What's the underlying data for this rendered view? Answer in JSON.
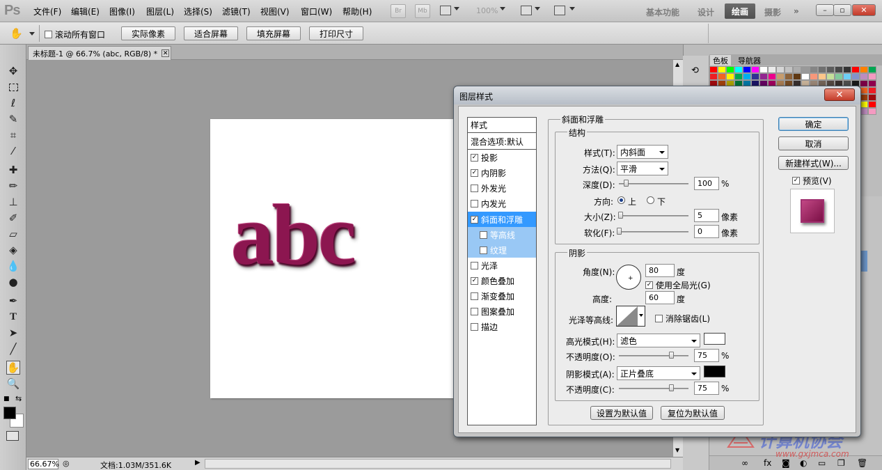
{
  "app": {
    "logo": "Ps"
  },
  "menu": [
    "文件(F)",
    "编辑(E)",
    "图像(I)",
    "图层(L)",
    "选择(S)",
    "滤镜(T)",
    "视图(V)",
    "窗口(W)",
    "帮助(H)"
  ],
  "topbar": {
    "br_label": "Br",
    "mb_label": "Mb",
    "zoom": "100%"
  },
  "workspaces": [
    "基本功能",
    "设计",
    "绘画",
    "摄影"
  ],
  "workspace_active": "绘画",
  "window_buttons": {
    "minimize": "–",
    "restore": "▫",
    "close": "✕"
  },
  "options": {
    "scroll_all": "滚动所有窗口",
    "buttons": [
      "实际像素",
      "适合屏幕",
      "填充屏幕",
      "打印尺寸"
    ]
  },
  "document": {
    "tab_title": "未标题-1 @ 66.7% (abc, RGB/8) *",
    "canvas_text": "abc",
    "zoom": "66.67%",
    "doc_info": "文档:1.03M/351.6K"
  },
  "panels": {
    "tabs": [
      "色板",
      "导航器"
    ]
  },
  "watermark": {
    "name": "计算机协会",
    "url": "www.gxjmca.com"
  },
  "dialog": {
    "title": "图层样式",
    "styles_header": "样式",
    "blend_default": "混合选项:默认",
    "effects": [
      {
        "label": "投影",
        "checked": "✓"
      },
      {
        "label": "内阴影",
        "checked": "✓"
      },
      {
        "label": "外发光",
        "checked": ""
      },
      {
        "label": "内发光",
        "checked": ""
      },
      {
        "label": "斜面和浮雕",
        "checked": "✓"
      },
      {
        "label": "等高线",
        "checked": ""
      },
      {
        "label": "纹理",
        "checked": ""
      },
      {
        "label": "光泽",
        "checked": ""
      },
      {
        "label": "颜色叠加",
        "checked": "✓"
      },
      {
        "label": "渐变叠加",
        "checked": ""
      },
      {
        "label": "图案叠加",
        "checked": ""
      },
      {
        "label": "描边",
        "checked": ""
      }
    ],
    "section_title": "斜面和浮雕",
    "structure": {
      "title": "结构",
      "style_label": "样式(T):",
      "style_value": "内斜面",
      "technique_label": "方法(Q):",
      "technique_value": "平滑",
      "depth_label": "深度(D):",
      "depth_value": "100",
      "depth_unit": "%",
      "depth_level": 0.1,
      "direction_label": "方向:",
      "dir_up": "上",
      "dir_down": "下",
      "size_label": "大小(Z):",
      "size_value": "5",
      "size_unit": "像素",
      "size_level": 0.02,
      "soften_label": "软化(F):",
      "soften_value": "0",
      "soften_unit": "像素",
      "soften_level": 0.0
    },
    "shading": {
      "title": "阴影",
      "angle_label": "角度(N):",
      "angle_value": "80",
      "angle_unit": "度",
      "global_light": "使用全局光(G)",
      "altitude_label": "高度:",
      "altitude_value": "60",
      "altitude_unit": "度",
      "gloss_label": "光泽等高线:",
      "anti_alias": "消除锯齿(L)",
      "highlight_label": "高光模式(H):",
      "highlight_mode": "滤色",
      "highlight_color": "#ffffff",
      "hl_opacity_label": "不透明度(O):",
      "hl_opacity_value": "75",
      "hl_opacity_unit": "%",
      "hl_opacity_level": 0.75,
      "shadow_label": "阴影模式(A):",
      "shadow_mode": "正片叠底",
      "shadow_color": "#000000",
      "sh_opacity_label": "不透明度(C):",
      "sh_opacity_value": "75",
      "sh_opacity_unit": "%",
      "sh_opacity_level": 0.75
    },
    "make_default": "设置为默认值",
    "reset_default": "复位为默认值",
    "ok": "确定",
    "cancel": "取消",
    "new_style": "新建样式(W)...",
    "preview": "预览(V)"
  },
  "colors": {
    "canvas_text": "#8c1650",
    "accent_selection": "#3399ff"
  }
}
